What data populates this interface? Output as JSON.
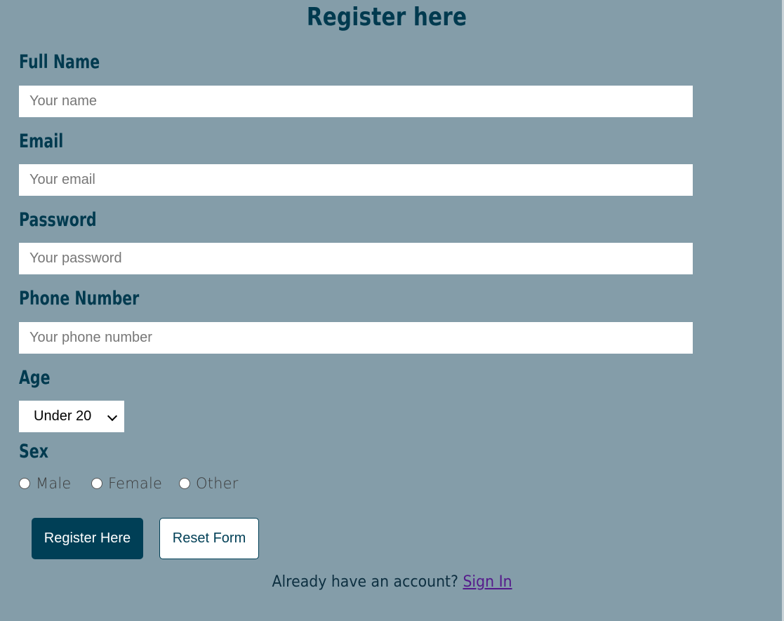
{
  "form": {
    "title": "Register here",
    "fields": {
      "full_name": {
        "label": "Full Name",
        "placeholder": "Your name"
      },
      "email": {
        "label": "Email",
        "placeholder": "Your email"
      },
      "password": {
        "label": "Password",
        "placeholder": "Your password"
      },
      "phone": {
        "label": "Phone Number",
        "placeholder": "Your phone number"
      }
    },
    "age": {
      "label": "Age",
      "selected": "Under 20"
    },
    "sex": {
      "label": "Sex",
      "options": [
        "Male",
        "Female",
        "Other"
      ]
    },
    "buttons": {
      "register": "Register Here",
      "reset": "Reset Form"
    },
    "footer": {
      "prompt": "Already have an account?",
      "link": "Sign In"
    }
  },
  "colors": {
    "background": "#849da9",
    "primary": "#003f56",
    "link": "#551a8b"
  }
}
